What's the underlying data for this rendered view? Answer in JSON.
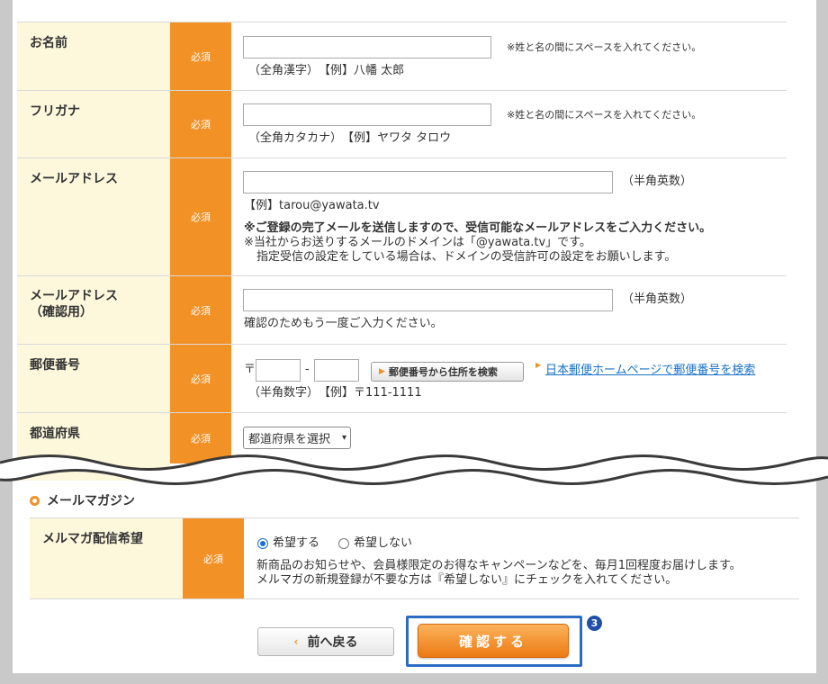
{
  "rows": [
    {
      "label": "お名前",
      "required": "必須",
      "note": "※姓と名の間にスペースを入れてください。",
      "hint": "（全角漢字）　【例】八幡 太郎"
    },
    {
      "label": "フリガナ",
      "required": "必須",
      "note": "※姓と名の間にスペースを入れてください。",
      "hint": "（全角カタカナ）　【例】ヤワタ タロウ"
    },
    {
      "label": "メールアドレス",
      "required": "必須",
      "suffix": "（半角英数）",
      "example": "【例】tarou@yawata.tv",
      "warning": "※ご登録の完了メールを送信しますので、受信可能なメールアドレスをご入力ください。",
      "domain_note": "※当社からお送りするメールのドメインは「@yawata.tv」です。",
      "domain_note2": "指定受信の設定をしている場合は、ドメインの受信許可の設定をお願いします。"
    },
    {
      "label": "メールアドレス\n（確認用）",
      "required": "必須",
      "suffix": "（半角英数）",
      "hint": "確認のためもう一度ご入力ください。"
    },
    {
      "label": "郵便番号",
      "required": "必須",
      "postal_mark": "〒",
      "dash": "-",
      "button": "郵便番号から住所を検索",
      "link": "日本郵便ホームページで郵便番号を検索",
      "hint": "（半角数字）　【例】〒111-1111"
    },
    {
      "label": "都道府県",
      "required": "必須",
      "select_value": "都道府県を選択"
    }
  ],
  "section": {
    "title": "メールマガジン"
  },
  "newsletter": {
    "label": "メルマガ配信希望",
    "required": "必須",
    "option_yes": "希望する",
    "option_no": "希望しない",
    "selected": "希望する",
    "desc1": "新商品のお知らせや、会員様限定のお得なキャンペーンなどを、毎月1回程度お届けします。",
    "desc2": "メルマガの新規登録が不要な方は『希望しない』にチェックを入れてください。"
  },
  "buttons": {
    "back": "前へ戻る",
    "confirm": "確認する"
  },
  "step_badge": "3",
  "colors": {
    "accent": "#f29126",
    "label_bg": "#fdf7dc",
    "highlight": "#2b6cc4",
    "link": "#1a72c6"
  }
}
